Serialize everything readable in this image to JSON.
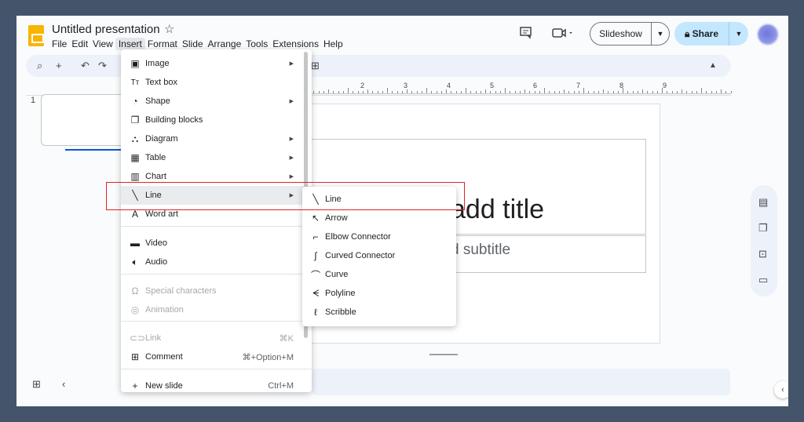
{
  "app": {
    "title": "Untitled presentation",
    "menubar": [
      "File",
      "Edit",
      "View",
      "Insert",
      "Format",
      "Slide",
      "Arrange",
      "Tools",
      "Extensions",
      "Help"
    ],
    "active_menu": "Insert"
  },
  "header": {
    "comments_icon": "comment-icon",
    "meet_icon": "video-camera-icon",
    "slideshow_label": "Slideshow",
    "share_label": "Share"
  },
  "ruler": {
    "labels": [
      "2",
      "3",
      "4",
      "5",
      "6",
      "7",
      "8",
      "9"
    ]
  },
  "filmstrip": {
    "slide_number": "1"
  },
  "slide": {
    "title_placeholder": "add title",
    "subtitle_placeholder": "d subtitle"
  },
  "insert_menu": {
    "items": [
      {
        "label": "Image",
        "icon": "image-icon",
        "submenu": true
      },
      {
        "label": "Text box",
        "icon": "text-box-icon"
      },
      {
        "label": "Shape",
        "icon": "shape-icon",
        "submenu": true
      },
      {
        "label": "Building blocks",
        "icon": "building-blocks-icon"
      },
      {
        "label": "Diagram",
        "icon": "diagram-icon",
        "submenu": true
      },
      {
        "label": "Table",
        "icon": "table-icon",
        "submenu": true
      },
      {
        "label": "Chart",
        "icon": "chart-icon",
        "submenu": true
      },
      {
        "label": "Line",
        "icon": "line-icon",
        "submenu": true,
        "highlighted": true
      },
      {
        "label": "Word art",
        "icon": "word-art-icon"
      },
      {
        "label": "Video",
        "icon": "video-icon"
      },
      {
        "label": "Audio",
        "icon": "audio-icon"
      },
      {
        "label": "Special characters",
        "icon": "omega-icon",
        "disabled": true
      },
      {
        "label": "Animation",
        "icon": "animation-icon",
        "disabled": true
      },
      {
        "label": "Link",
        "icon": "link-icon",
        "shortcut": "⌘K",
        "disabled": true
      },
      {
        "label": "Comment",
        "icon": "comment-add-icon",
        "shortcut": "⌘+Option+M"
      },
      {
        "label": "New slide",
        "icon": "plus-icon",
        "shortcut": "Ctrl+M"
      }
    ]
  },
  "line_submenu": {
    "items": [
      {
        "label": "Line",
        "icon": "line-icon"
      },
      {
        "label": "Arrow",
        "icon": "arrow-icon"
      },
      {
        "label": "Elbow Connector",
        "icon": "elbow-connector-icon"
      },
      {
        "label": "Curved Connector",
        "icon": "curved-connector-icon"
      },
      {
        "label": "Curve",
        "icon": "curve-icon"
      },
      {
        "label": "Polyline",
        "icon": "polyline-icon"
      },
      {
        "label": "Scribble",
        "icon": "scribble-icon"
      }
    ]
  },
  "colors": {
    "background": "#44546a",
    "share_button": "#c2e7ff",
    "highlight_box": "#e02424",
    "menu_hover": "#e9ecef"
  }
}
